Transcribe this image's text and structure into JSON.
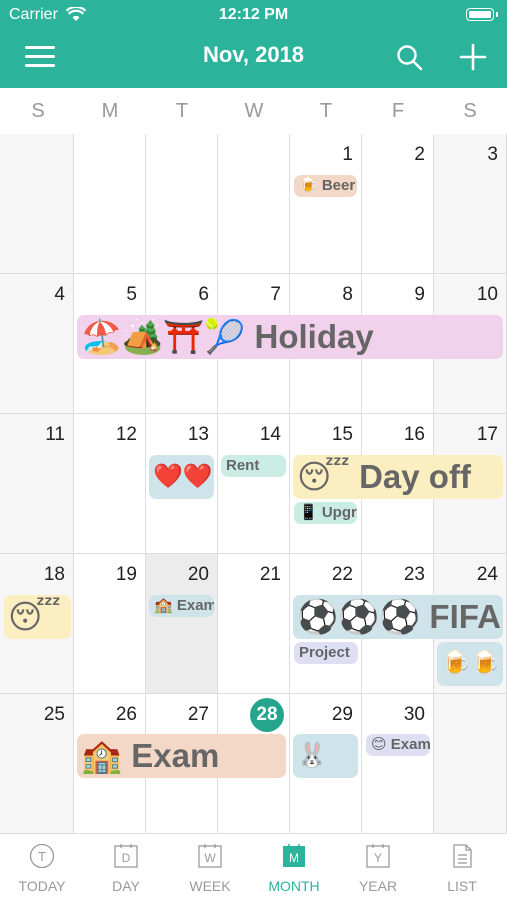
{
  "status": {
    "carrier": "Carrier",
    "time": "12:12 PM"
  },
  "nav": {
    "title": "Nov, 2018",
    "menu_icon": "hamburger-menu-icon",
    "search_icon": "search-icon",
    "add_icon": "plus-icon"
  },
  "weekdays": [
    "S",
    "M",
    "T",
    "W",
    "T",
    "F",
    "S"
  ],
  "days": [
    "",
    "",
    "",
    "",
    "1",
    "2",
    "3",
    "4",
    "5",
    "6",
    "7",
    "8",
    "9",
    "10",
    "11",
    "12",
    "13",
    "14",
    "15",
    "16",
    "17",
    "18",
    "19",
    "20",
    "21",
    "22",
    "23",
    "24",
    "25",
    "26",
    "27",
    "28",
    "29",
    "30",
    ""
  ],
  "today": "28",
  "events": [
    {
      "label": "🍺 Beer",
      "color": "#f3d8c7"
    },
    {
      "label": "🏖️🏕️⛩️🎾 Holiday",
      "color": "#f1d1ec"
    },
    {
      "label": "❤️❤️",
      "color": "#cfe4ea"
    },
    {
      "label": "Rent",
      "color": "#c9ece3"
    },
    {
      "label": "😴 Day off",
      "color": "#fbeec0"
    },
    {
      "label": "📱 Upgrade",
      "color": "#c9ece3"
    },
    {
      "label": "😴 Day off",
      "color": "#fbeec0"
    },
    {
      "label": "🏫 Exam",
      "color": "#cfe4ea"
    },
    {
      "label": "⚽⚽⚽ FIFA",
      "color": "#cfe4ea"
    },
    {
      "label": "Project",
      "color": "#dedff2"
    },
    {
      "label": "🍺🍺",
      "color": "#cfe4ea"
    },
    {
      "label": "🏫 Exam",
      "color": "#f3d8c7"
    },
    {
      "label": "🐰",
      "color": "#cfe4ea"
    },
    {
      "label": "😊 Exam",
      "color": "#dedff2"
    }
  ],
  "tabs": [
    {
      "label": "TODAY",
      "icon": "today-icon",
      "letter": "T"
    },
    {
      "label": "DAY",
      "icon": "day-icon",
      "letter": "D"
    },
    {
      "label": "WEEK",
      "icon": "week-icon",
      "letter": "W"
    },
    {
      "label": "MONTH",
      "icon": "month-icon",
      "letter": "M"
    },
    {
      "label": "YEAR",
      "icon": "year-icon",
      "letter": "Y"
    },
    {
      "label": "LIST",
      "icon": "list-icon",
      "letter": ""
    }
  ],
  "colors": {
    "accent": "#2bb39b",
    "today": "#25a58c"
  }
}
